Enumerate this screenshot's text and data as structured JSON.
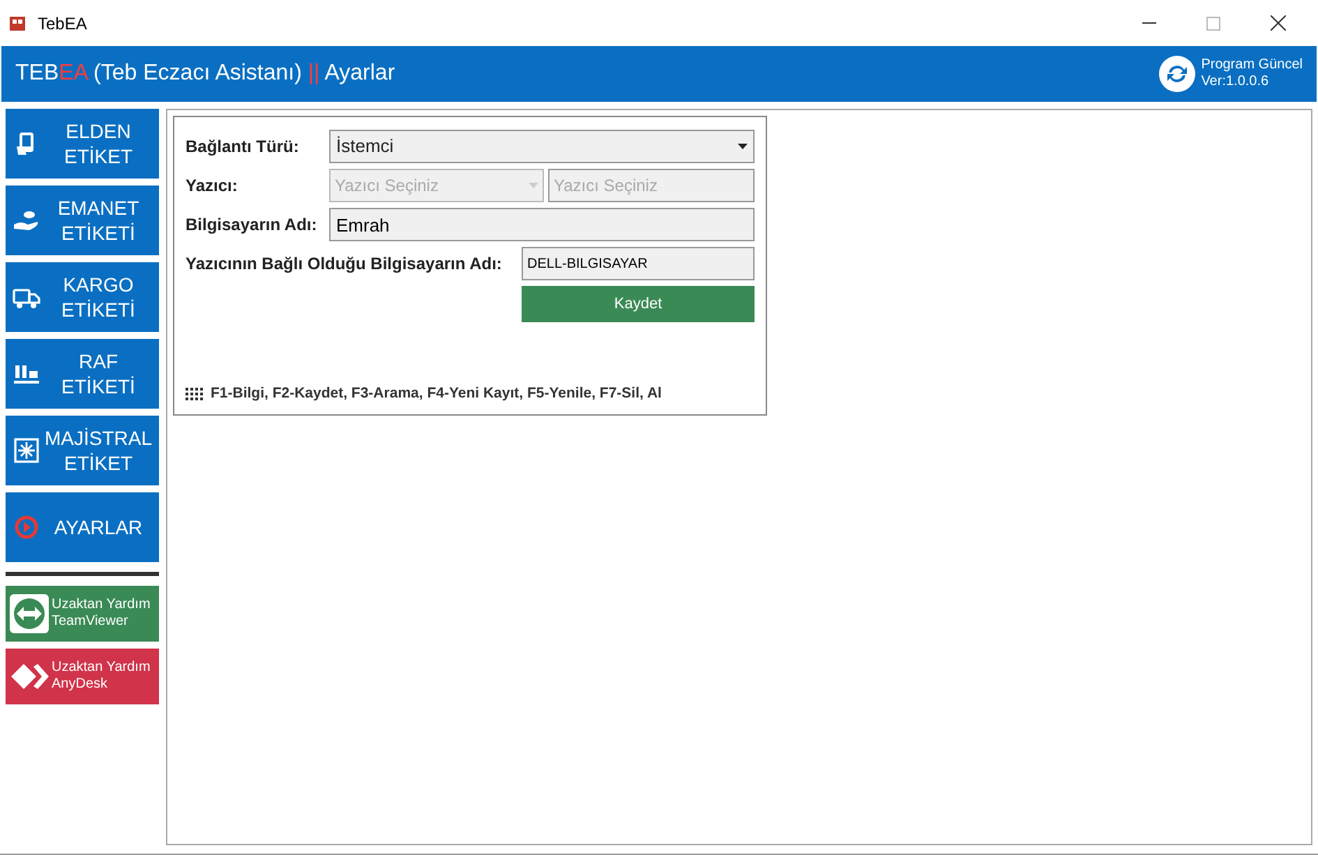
{
  "window": {
    "title": "TebEA"
  },
  "header": {
    "brand_prefix": "TEB",
    "brand_accent": "EA",
    "subtitle": "(Teb Eczacı Asistanı)",
    "separator": "||",
    "page": "Ayarlar",
    "status": "Program Güncel",
    "version": "Ver:1.0.0.6"
  },
  "sidebar": {
    "items": [
      {
        "kind": "nav",
        "lines": [
          "ELDEN",
          "ETİKET"
        ]
      },
      {
        "kind": "nav",
        "lines": [
          "EMANET",
          "ETİKETİ"
        ]
      },
      {
        "kind": "nav",
        "lines": [
          "KARGO",
          "ETİKETİ"
        ]
      },
      {
        "kind": "nav",
        "lines": [
          "RAF",
          "ETİKETİ"
        ]
      },
      {
        "kind": "nav",
        "lines": [
          "MAJİSTRAL",
          "ETİKET"
        ]
      },
      {
        "kind": "nav",
        "lines": [
          "AYARLAR"
        ]
      },
      {
        "kind": "divider"
      },
      {
        "kind": "remote",
        "lines": [
          "Uzaktan Yardım",
          "TeamViewer"
        ]
      },
      {
        "kind": "remote",
        "lines": [
          "Uzaktan Yardım",
          "AnyDesk"
        ]
      }
    ]
  },
  "form": {
    "connection_label": "Bağlantı Türü:",
    "connection_value": "İstemci",
    "printer_label": "Yazıcı:",
    "printer_select_placeholder": "Yazıcı Seçiniz",
    "printer_text_placeholder": "Yazıcı Seçiniz",
    "computer_label": "Bilgisayarın Adı:",
    "computer_value": "Emrah",
    "host_label": "Yazıcının Bağlı Olduğu Bilgisayarın Adı:",
    "host_value": "DELL-BILGISAYAR",
    "save_button": "Kaydet",
    "shortcuts": "F1-Bilgi, F2-Kaydet, F3-Arama, F4-Yeni Kayıt, F5-Yenile, F7-Sil, Al"
  }
}
